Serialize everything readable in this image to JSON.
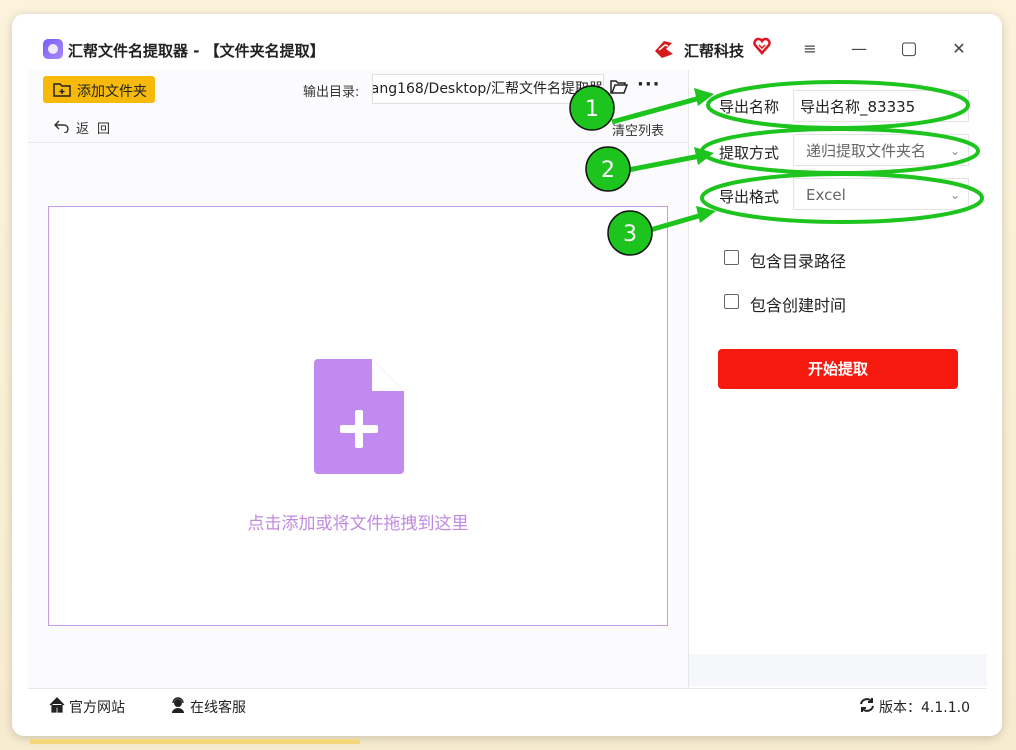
{
  "titlebar": {
    "app_title": "汇帮文件名提取器 - 【文件夹名提取】",
    "brand_name": "汇帮科技",
    "controls": [
      "≡",
      "—",
      "▢",
      "✕"
    ]
  },
  "toolbar": {
    "add_folder_label": "添加文件夹",
    "back_label": "返回",
    "output_dir_label": "输出目录:",
    "output_dir_value": "ang168/Desktop/汇帮文件名提取器",
    "more_label": "···",
    "clear_list_label": "清空列表"
  },
  "drop_zone": {
    "text": "点击添加或将文件拖拽到这里"
  },
  "settings": {
    "export_name_label": "导出名称",
    "export_name_value": "导出名称_83335",
    "method_label": "提取方式",
    "method_value": "递归提取文件夹名",
    "format_label": "导出格式",
    "format_value": "Excel",
    "include_path_label": "包含目录路径",
    "include_path_checked": false,
    "include_ctime_label": "包含创建时间",
    "include_ctime_checked": false,
    "start_label": "开始提取"
  },
  "statusbar": {
    "website_label": "官方网站",
    "support_label": "在线客服",
    "version_label": "版本：4.1.1.0"
  },
  "annotations": {
    "markers": [
      "1",
      "2",
      "3"
    ],
    "color": "#1ec41e"
  },
  "colors": {
    "accent_yellow": "#f7b90a",
    "start_red": "#f5190e",
    "drop_purple": "#c08ae0",
    "icon_purple": "#c08af0"
  }
}
